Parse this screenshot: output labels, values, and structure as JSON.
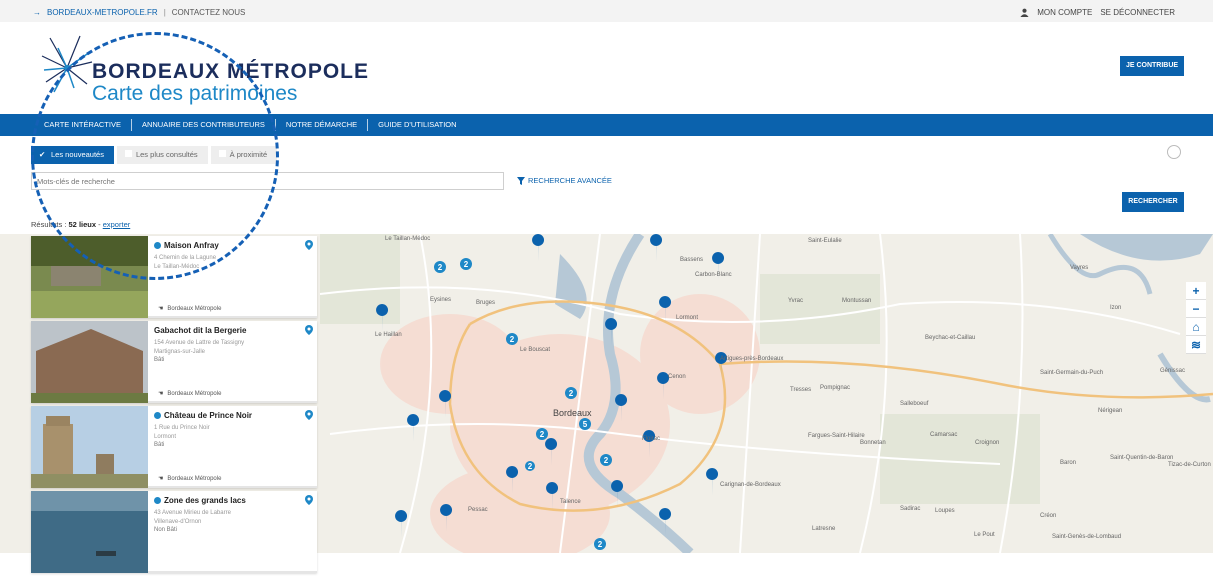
{
  "topbar": {
    "site_link": "BORDEAUX-METROPOLE.FR",
    "contact": "CONTACTEZ NOUS",
    "account": "MON COMPTE",
    "logout": "SE DÉCONNECTER"
  },
  "logo": {
    "title": "BORDEAUX MÉTROPOLE",
    "subtitle": "Carte des patrimoines"
  },
  "contribute_label": "JE CONTRIBUE",
  "nav": [
    "CARTE INTÉRACTIVE",
    "ANNUAIRE DES CONTRIBUTEURS",
    "NOTRE DÉMARCHE",
    "GUIDE D'UTILISATION"
  ],
  "filters": [
    "Les nouveautés",
    "Les plus consultés",
    "À proximité"
  ],
  "search": {
    "placeholder": "Mots-clés de recherche",
    "advanced": "RECHERCHE AVANCÉE",
    "button": "RECHERCHER"
  },
  "results": {
    "prefix": "Résultats : ",
    "count": "52 lieux",
    "sep": " - ",
    "export": "exporter"
  },
  "places": [
    {
      "name": "Maison Anfray",
      "address1": "4 Chemin de la Lagune",
      "address2": "Le Taillan-Médoc",
      "type": "",
      "owner": "Bordeaux Métropole"
    },
    {
      "name": "Gabachot dit la Bergerie",
      "address1": "154 Avenue de Lattre de Tassigny",
      "address2": "Martignas-sur-Jalle",
      "type": "Bâti",
      "owner": "Bordeaux Métropole"
    },
    {
      "name": "Château de Prince Noir",
      "address1": "1 Rue du Prince Noir",
      "address2": "Lormont",
      "type": "Bâti",
      "owner": "Bordeaux Métropole"
    },
    {
      "name": "Zone des grands lacs",
      "address1": "43 Avenue Mirieu de Labarre",
      "address2": "Villenave-d'Ornon",
      "type": "Non Bâti",
      "owner": ""
    }
  ],
  "map": {
    "labels": [
      "Eysines",
      "Bruges",
      "Le Haillan",
      "Le Bouscat",
      "Bordeaux",
      "Lormont",
      "Cenon",
      "Floirac",
      "Pessac",
      "Talence",
      "Bassens",
      "Carbon-Blanc",
      "Artigues-près-Bordeaux",
      "Yvrac",
      "Montussan",
      "Beychac-et-Caillau",
      "Pompignac",
      "Tresses",
      "Salleboeuf",
      "Fargues-Saint-Hilaire",
      "Bonnetan",
      "Camarsac",
      "Croignon",
      "Baron",
      "Saint-Quentin-de-Baron",
      "Nérigean",
      "Génissac",
      "Saint-Germain-du-Puch",
      "Vayres",
      "Izon",
      "Saint-Eulalie",
      "Le Taillan-Médoc",
      "Carignan-de-Bordeaux",
      "Latresne",
      "Sadirac",
      "Loupes",
      "Créon",
      "Le Pout",
      "Saint-Genès-de-Lombaud",
      "Tizac-de-Curton"
    ],
    "clusters": [
      "2",
      "2",
      "2",
      "2",
      "5",
      "2",
      "2",
      "2",
      "2"
    ]
  },
  "colors": {
    "primary": "#0b62ad",
    "accent": "#1e88c7",
    "river": "#b6c8d6"
  }
}
